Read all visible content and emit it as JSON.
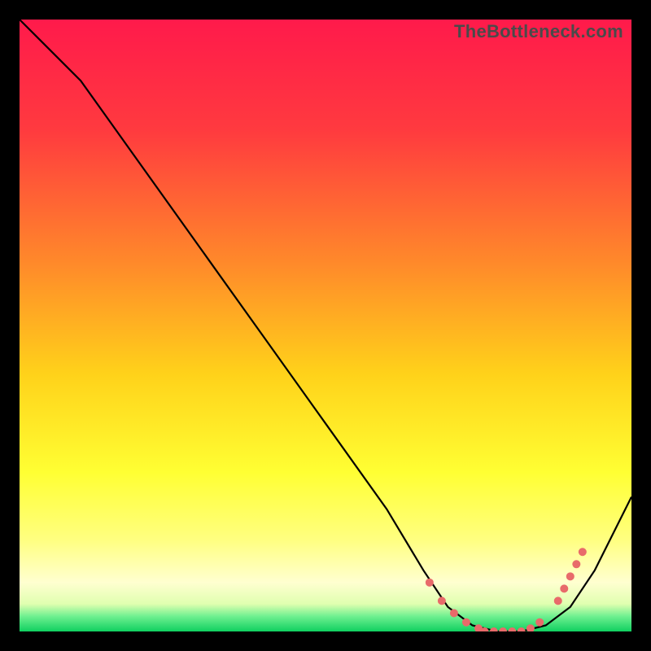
{
  "watermark": "TheBottleneck.com",
  "chart_data": {
    "type": "line",
    "title": "",
    "xlabel": "",
    "ylabel": "",
    "xlim": [
      0,
      100
    ],
    "ylim": [
      0,
      100
    ],
    "grid": false,
    "legend": false,
    "background_gradient_stops": [
      {
        "offset": 0.0,
        "color": "#ff1a4b"
      },
      {
        "offset": 0.18,
        "color": "#ff3a3f"
      },
      {
        "offset": 0.4,
        "color": "#ff8a2a"
      },
      {
        "offset": 0.58,
        "color": "#ffd21a"
      },
      {
        "offset": 0.74,
        "color": "#ffff33"
      },
      {
        "offset": 0.85,
        "color": "#ffff80"
      },
      {
        "offset": 0.92,
        "color": "#ffffd0"
      },
      {
        "offset": 0.955,
        "color": "#e0ffb0"
      },
      {
        "offset": 0.975,
        "color": "#70f090"
      },
      {
        "offset": 1.0,
        "color": "#10d060"
      }
    ],
    "series": [
      {
        "name": "bottleneck-curve",
        "x": [
          0,
          4,
          10,
          20,
          30,
          40,
          50,
          60,
          66,
          70,
          74,
          78,
          82,
          86,
          90,
          94,
          100
        ],
        "y": [
          100,
          96,
          90,
          76,
          62,
          48,
          34,
          20,
          10,
          4,
          1,
          0,
          0,
          1,
          4,
          10,
          22
        ],
        "color": "#000000",
        "width": 2.2
      }
    ],
    "marker_groups": [
      {
        "name": "trough-markers",
        "color": "#e86a6a",
        "radius": 5,
        "points": [
          {
            "x": 67,
            "y": 8
          },
          {
            "x": 69,
            "y": 5
          },
          {
            "x": 71,
            "y": 3
          },
          {
            "x": 73,
            "y": 1.5
          },
          {
            "x": 75,
            "y": 0.5
          },
          {
            "x": 76,
            "y": 0
          },
          {
            "x": 77.5,
            "y": 0
          },
          {
            "x": 79,
            "y": 0
          },
          {
            "x": 80.5,
            "y": 0
          },
          {
            "x": 82,
            "y": 0
          },
          {
            "x": 83.5,
            "y": 0.5
          },
          {
            "x": 85,
            "y": 1.5
          },
          {
            "x": 88,
            "y": 5
          },
          {
            "x": 89,
            "y": 7
          },
          {
            "x": 90,
            "y": 9
          },
          {
            "x": 91,
            "y": 11
          },
          {
            "x": 92,
            "y": 13
          }
        ]
      }
    ]
  }
}
